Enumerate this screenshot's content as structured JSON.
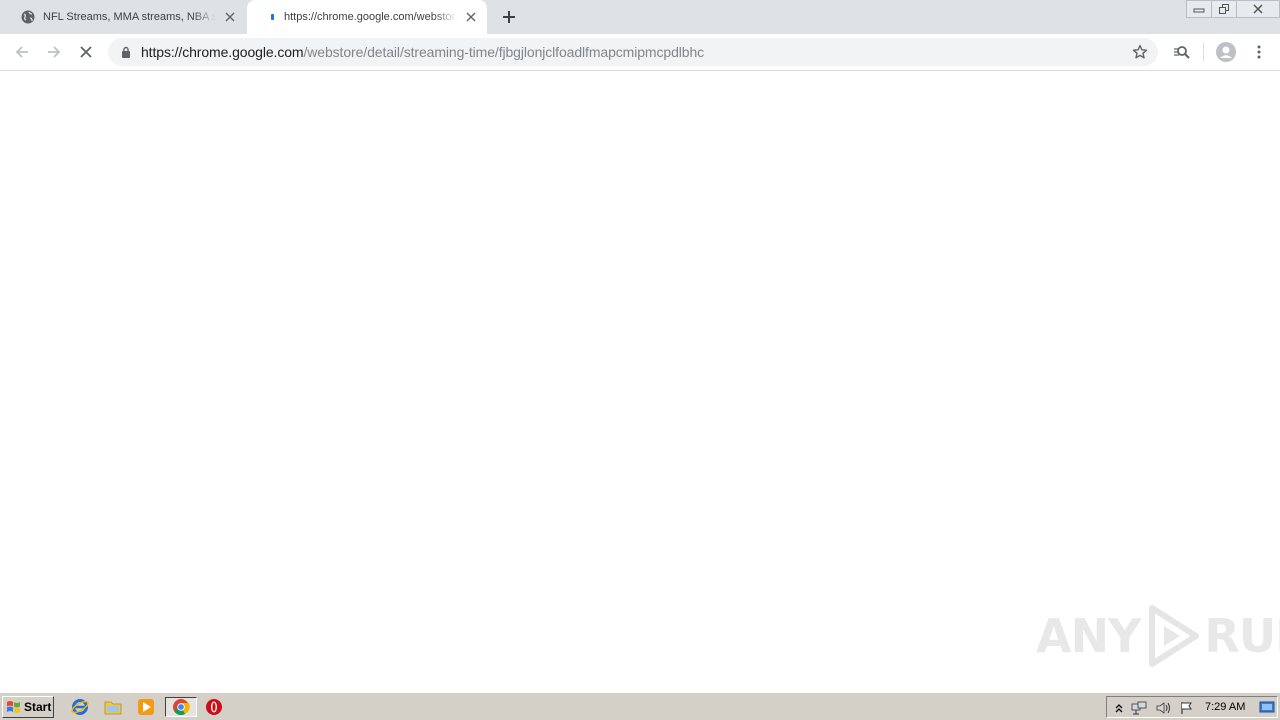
{
  "browser": {
    "tabs": [
      {
        "title": "NFL Streams, MMA streams, NBA streams",
        "state": "inactive",
        "favicon": "globe-icon"
      },
      {
        "title": "https://chrome.google.com/webstore/detail/streaming-time/fjbgjlonjclfoadlfmapcmipmcpdlbhc",
        "state": "active-loading",
        "favicon": "loading-spinner-icon"
      }
    ],
    "new_tab_icon": "plus-icon",
    "window_controls": [
      "minimize-icon",
      "restore-icon",
      "close-icon"
    ]
  },
  "toolbar": {
    "url_host": "https://chrome.google.com",
    "url_path": "/webstore/detail/streaming-time/fjbgjlonjclfoadlfmapcmipmcpdlbhc",
    "icons": [
      "back-arrow-icon",
      "forward-arrow-icon",
      "stop-loading-icon",
      "lock-icon",
      "bookmark-star-icon",
      "extension-icon",
      "profile-avatar-icon",
      "menu-kebab-icon"
    ]
  },
  "content": {
    "watermark_left": "ANY",
    "watermark_right": "RUN"
  },
  "taskbar": {
    "start_label": "Start",
    "quick_launch": [
      "internet-explorer-icon",
      "folder-icon",
      "media-player-icon",
      "chrome-icon",
      "opera-icon"
    ],
    "clock": "7:29 AM",
    "tray_icons": [
      "show-hidden-icons-icon",
      "network-icon",
      "volume-icon",
      "action-center-flag-icon"
    ]
  },
  "colors": {
    "tabstrip": "#dee1e6",
    "omnibox": "#f1f3f4",
    "taskbar": "#d4d0c8",
    "loading": "#1a73e8"
  }
}
